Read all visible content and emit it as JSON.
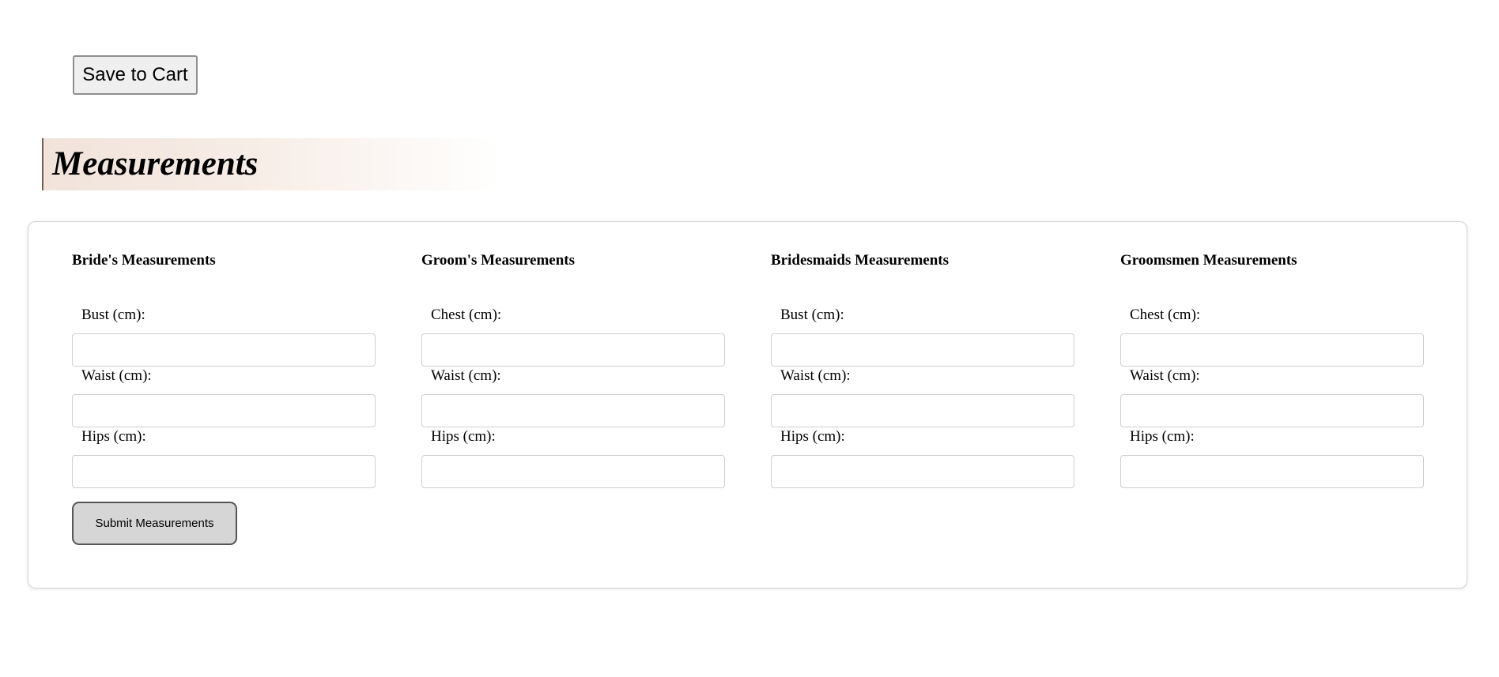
{
  "toolbar": {
    "save_label": "Save to Cart"
  },
  "page": {
    "heading": "Measurements"
  },
  "groups": [
    {
      "title": "Bride's Measurements",
      "fields": [
        {
          "label": "Bust (cm):",
          "value": ""
        },
        {
          "label": "Waist (cm):",
          "value": ""
        },
        {
          "label": "Hips (cm):",
          "value": ""
        }
      ]
    },
    {
      "title": "Groom's Measurements",
      "fields": [
        {
          "label": "Chest (cm):",
          "value": ""
        },
        {
          "label": "Waist (cm):",
          "value": ""
        },
        {
          "label": "Hips (cm):",
          "value": ""
        }
      ]
    },
    {
      "title": "Bridesmaids Measurements",
      "fields": [
        {
          "label": "Bust (cm):",
          "value": ""
        },
        {
          "label": "Waist (cm):",
          "value": ""
        },
        {
          "label": "Hips (cm):",
          "value": ""
        }
      ]
    },
    {
      "title": "Groomsmen Measurements",
      "fields": [
        {
          "label": "Chest (cm):",
          "value": ""
        },
        {
          "label": "Waist (cm):",
          "value": ""
        },
        {
          "label": "Hips (cm):",
          "value": ""
        }
      ]
    }
  ],
  "form": {
    "submit_label": "Submit Measurements"
  },
  "colors": {
    "heading_gradient": "#f1e3da",
    "heading_border": "#7a5a48",
    "submit_bg": "#d6d6d6",
    "save_bg": "#efefef"
  }
}
